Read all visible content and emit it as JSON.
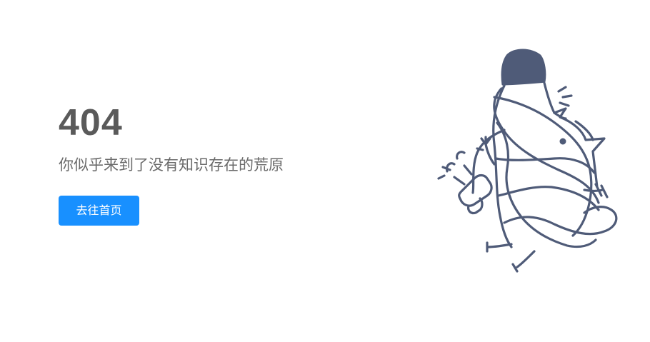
{
  "error": {
    "code": "404",
    "message": "你似乎来到了没有知识存在的荒原"
  },
  "actions": {
    "home_button_label": "去往首页"
  },
  "theme": {
    "accent": "#1890ff",
    "heading_color": "#5a5a5a",
    "text_color": "#6a6a6a",
    "illustration_stroke": "#4f5b78"
  },
  "illustration": {
    "icon": "unplugged-character-illustration"
  }
}
